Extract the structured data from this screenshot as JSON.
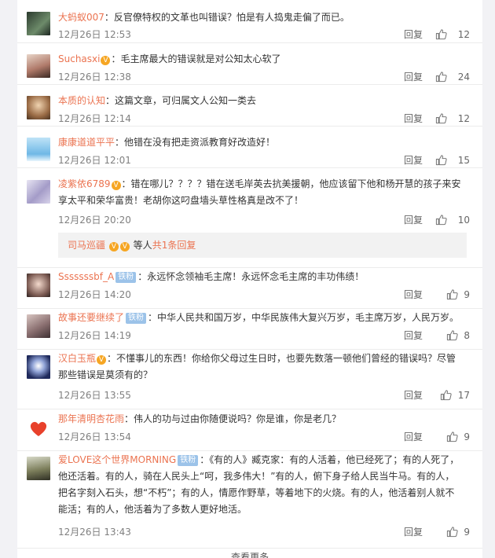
{
  "colors": {
    "username": "#eb7350",
    "badge": "#9cc3e9",
    "meta": "#808080"
  },
  "reply_label": "回复",
  "thumb_icon": "thumb-up-icon",
  "comments": [
    {
      "user": "大蚂蚁007",
      "badge": "",
      "text": "：反官僚特权的文革也叫错误？怕是有人捣鬼走偏了而已。",
      "time": "12月26日 12:53",
      "likes": "12"
    },
    {
      "user": "Suchasxi",
      "badge": "",
      "text": "：毛主席最大的错误就是对公知太心软了",
      "time": "12月26日 12:38",
      "likes": "24"
    },
    {
      "user": "本质的认知",
      "badge": "",
      "text": "：这篇文章，可归属文人公知一类去",
      "time": "12月26日 12:14",
      "likes": "12"
    },
    {
      "user": "康康道道平平",
      "badge": "",
      "text": "：他错在没有把走资派教育好改造好！",
      "time": "12月26日 12:01",
      "likes": "15"
    },
    {
      "user": "凌紫依6789",
      "badge": "",
      "text": "：错在哪儿？？？？错在送毛岸英去抗美援朝，他应该留下他和杨开慧的孩子来安享太平和荣华富贵！老胡你这叼盘墙头草性格真是改不了！",
      "time": "12月26日 20:20",
      "likes": "10"
    },
    {
      "user": "Sssssssbf_A",
      "badge": "铁粉",
      "text": "：永远怀念领袖毛主席！永远怀念毛主席的丰功伟绩！",
      "time": "12月26日 14:20",
      "likes": "9"
    },
    {
      "user": "故事还要继续了",
      "badge": "铁粉",
      "text": "：中华人民共和国万岁，中华民族伟大复兴万岁，毛主席万岁，人民万岁。",
      "time": "12月26日 14:19",
      "likes": "8"
    },
    {
      "user": "汉白玉瓶",
      "badge": "",
      "text": "：不懂事儿的东西！你给你父母过生日时，也要先数落一顿他们曾经的错误吗？尽管那些错误是莫须有的？",
      "time": "12月26日 13:55",
      "likes": "17"
    },
    {
      "user": "那年清明杏花雨",
      "badge": "",
      "text": "：伟人的功与过由你随便说吗？你是谁，你是老几？",
      "time": "12月26日 13:54",
      "likes": "9"
    },
    {
      "user": "爱LOVE这个世界MORNING",
      "badge": "铁粉",
      "text": "：《有的人》臧克家：有的人活着，他已经死了；有的人死了，他还活着。有的人，骑在人民头上“呵，我多伟大！”有的人，俯下身子给人民当牛马。有的人，把名字刻入石头，想“不朽”；有的人，情愿作野草，等着地下的火烧。有的人，他活着别人就不能活；有的人，他活着为了多数人更好地活。",
      "time": "12月26日 13:43",
      "likes": "9"
    }
  ],
  "sub_reply": {
    "user": "司马巡疆",
    "middle": "等人",
    "link": "共1条回复"
  },
  "more_label": "查看更多"
}
